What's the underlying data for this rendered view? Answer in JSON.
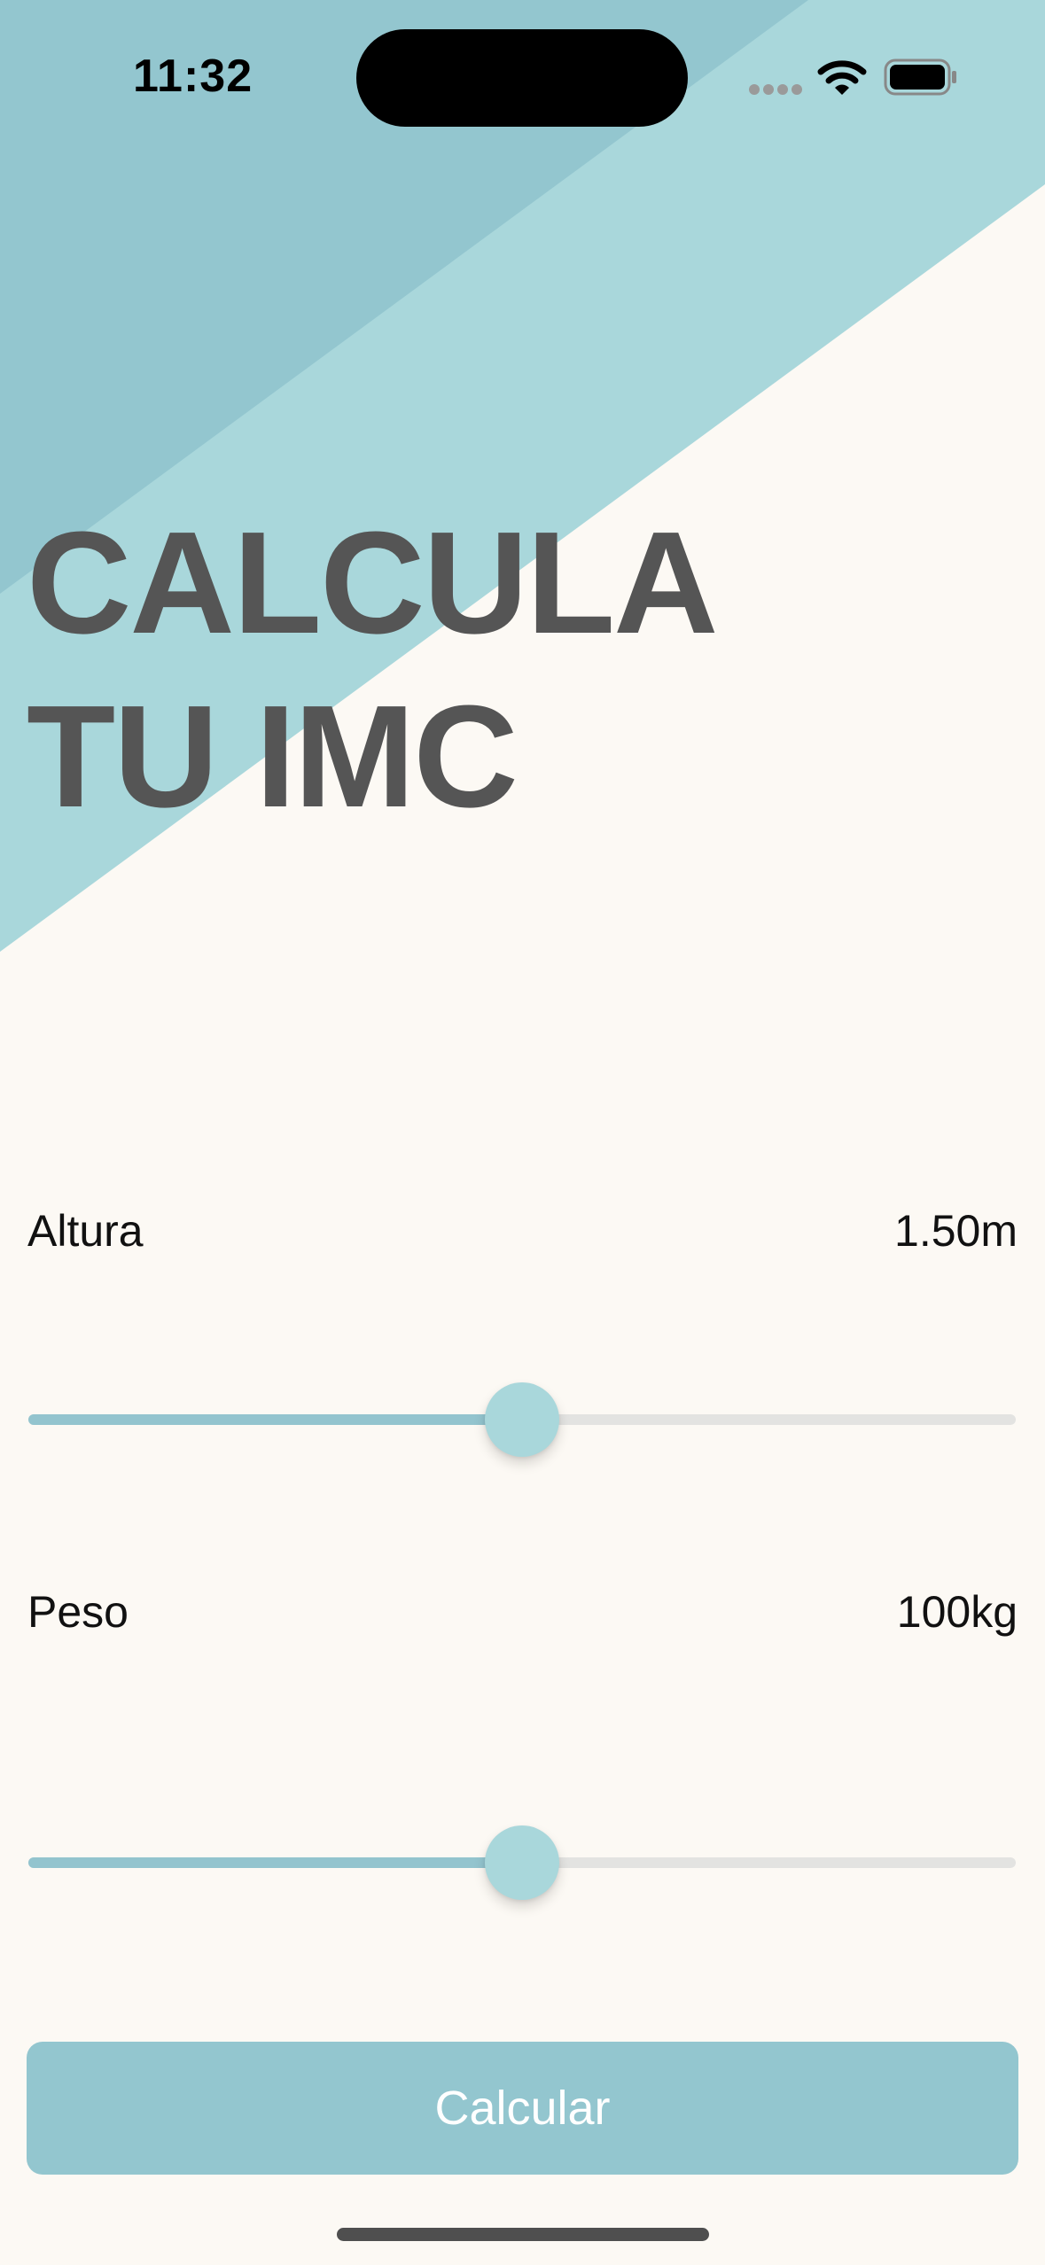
{
  "status_bar": {
    "time": "11:32"
  },
  "header": {
    "title_line1": "CALCULA",
    "title_line2": "TU IMC"
  },
  "height_field": {
    "label": "Altura",
    "value": "1.50m",
    "slider_fraction": 0.5
  },
  "weight_field": {
    "label": "Peso",
    "value": "100kg",
    "slider_fraction": 0.5
  },
  "action": {
    "calculate_label": "Calcular"
  },
  "icons": {
    "signal": "cellular-signal-icon",
    "wifi": "wifi-icon",
    "battery": "battery-icon"
  },
  "colors": {
    "background": "#FCF9F4",
    "stripe_dark": "#93C6CF",
    "stripe_light": "#A9D7DB",
    "title": "#555555",
    "slider_fill": "#93C4CE",
    "slider_track": "#E3E3E1",
    "slider_thumb": "#A9D7DB",
    "button_bg": "#93C6CF",
    "button_text": "#FFFFFF"
  }
}
